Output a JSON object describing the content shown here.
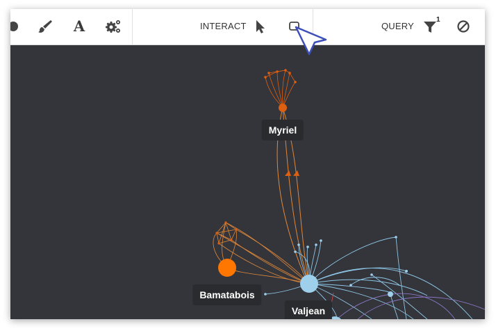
{
  "toolbar": {
    "tools": [
      {
        "icon": "circle-cut-icon"
      },
      {
        "icon": "paintbrush-icon"
      },
      {
        "icon": "font-icon",
        "glyph": "A"
      },
      {
        "icon": "gears-icon"
      }
    ],
    "interact": {
      "label": "INTERACT",
      "pointer_icon": "pointer-arrow-icon",
      "select_icon": "rect-select-icon"
    },
    "query": {
      "label": "QUERY",
      "filter_icon": "filter-icon",
      "filter_count": "1",
      "clear_icon": "ban-icon"
    }
  },
  "graph": {
    "labels": {
      "myriel": "Myriel",
      "bamatabois": "Bamatabois",
      "valjean": "Valjean"
    },
    "colors": {
      "background": "#34353a",
      "orange": "#ff7700",
      "dark_orange": "#dd5f10",
      "light_blue": "#9ed0ec",
      "edge_orange": "#e0883a",
      "edge_blue": "#8fc7e8",
      "edge_purple": "#8a75c4"
    }
  }
}
